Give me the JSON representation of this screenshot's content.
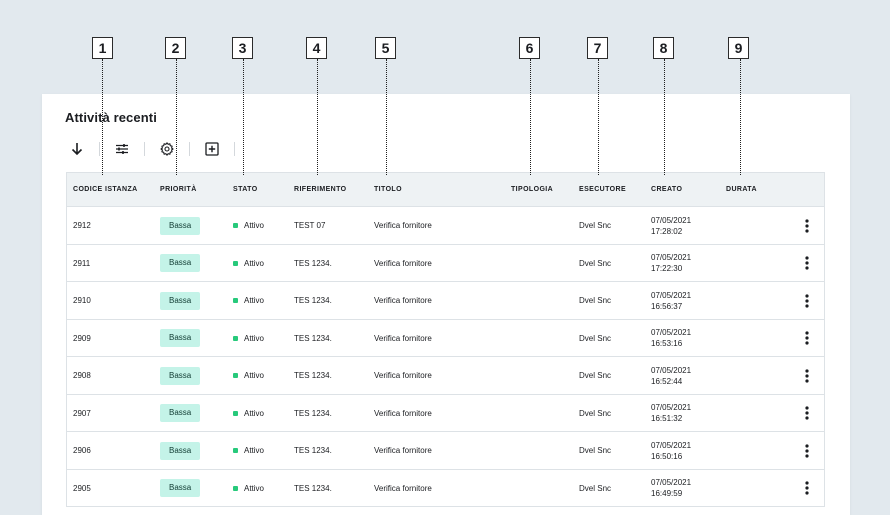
{
  "callouts": [
    "1",
    "2",
    "3",
    "4",
    "5",
    "6",
    "7",
    "8",
    "9"
  ],
  "card": {
    "title": "Attività recenti"
  },
  "toolbar": {
    "icons": [
      "arrow-down-icon",
      "sliders-icon",
      "gear-icon",
      "add-box-icon"
    ]
  },
  "table": {
    "columns": [
      "CODICE ISTANZA",
      "PRIORITÀ",
      "STATO",
      "RIFERIMENTO",
      "TITOLO",
      "TIPOLOGIA",
      "ESECUTORE",
      "CREATO",
      "DURATA"
    ],
    "rows": [
      {
        "code": "2912",
        "priority": "Bassa",
        "status": "Attivo",
        "ref": "TEST 07",
        "title": "Verifica fornitore",
        "type": "",
        "executor": "Dvel Snc",
        "date": "07/05/2021",
        "time": "17:28:02",
        "duration": ""
      },
      {
        "code": "2911",
        "priority": "Bassa",
        "status": "Attivo",
        "ref": "TES 1234.",
        "title": "Verifica fornitore",
        "type": "",
        "executor": "Dvel Snc",
        "date": "07/05/2021",
        "time": "17:22:30",
        "duration": ""
      },
      {
        "code": "2910",
        "priority": "Bassa",
        "status": "Attivo",
        "ref": "TES 1234.",
        "title": "Verifica fornitore",
        "type": "",
        "executor": "Dvel Snc",
        "date": "07/05/2021",
        "time": "16:56:37",
        "duration": ""
      },
      {
        "code": "2909",
        "priority": "Bassa",
        "status": "Attivo",
        "ref": "TES 1234.",
        "title": "Verifica fornitore",
        "type": "",
        "executor": "Dvel Snc",
        "date": "07/05/2021",
        "time": "16:53:16",
        "duration": ""
      },
      {
        "code": "2908",
        "priority": "Bassa",
        "status": "Attivo",
        "ref": "TES 1234.",
        "title": "Verifica fornitore",
        "type": "",
        "executor": "Dvel Snc",
        "date": "07/05/2021",
        "time": "16:52:44",
        "duration": ""
      },
      {
        "code": "2907",
        "priority": "Bassa",
        "status": "Attivo",
        "ref": "TES 1234.",
        "title": "Verifica fornitore",
        "type": "",
        "executor": "Dvel Snc",
        "date": "07/05/2021",
        "time": "16:51:32",
        "duration": ""
      },
      {
        "code": "2906",
        "priority": "Bassa",
        "status": "Attivo",
        "ref": "TES 1234.",
        "title": "Verifica fornitore",
        "type": "",
        "executor": "Dvel Snc",
        "date": "07/05/2021",
        "time": "16:50:16",
        "duration": ""
      },
      {
        "code": "2905",
        "priority": "Bassa",
        "status": "Attivo",
        "ref": "TES 1234.",
        "title": "Verifica fornitore",
        "type": "",
        "executor": "Dvel Snc",
        "date": "07/05/2021",
        "time": "16:49:59",
        "duration": ""
      }
    ],
    "row_menu_icon": "kebab-icon"
  },
  "colors": {
    "background": "#e2e9ee",
    "header_bg": "#eef2f4",
    "badge_bg": "#c4f3e8",
    "status_active": "#27c97b"
  }
}
